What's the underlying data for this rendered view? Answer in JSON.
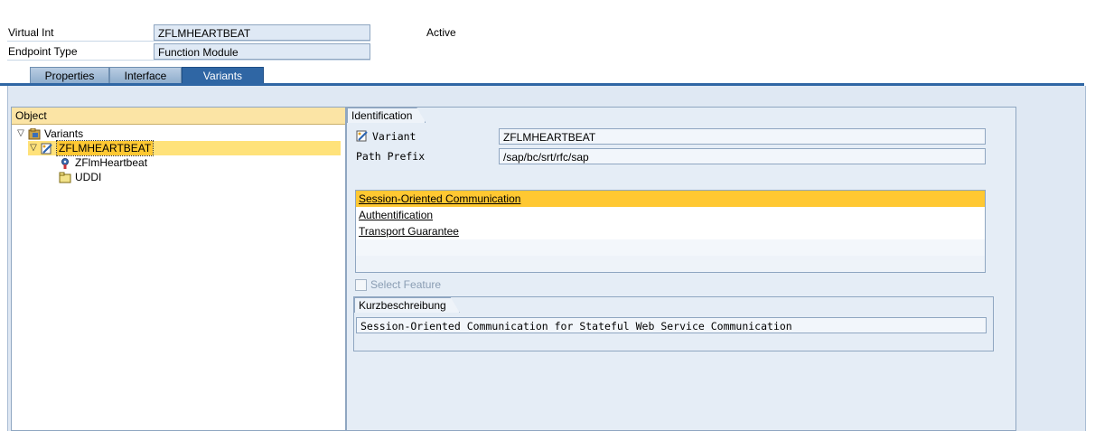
{
  "header": {
    "virtual_int_label": "Virtual Int",
    "virtual_int_value": "ZFLMHEARTBEAT",
    "status": "Active",
    "endpoint_type_label": "Endpoint Type",
    "endpoint_type_value": "Function Module"
  },
  "tabs": [
    {
      "label": "Properties"
    },
    {
      "label": "Interface"
    },
    {
      "label": "Variants"
    }
  ],
  "tree": {
    "header": "Object",
    "items": [
      {
        "label": "Variants",
        "icon": "variants-folder-icon"
      },
      {
        "label": "ZFLMHEARTBEAT",
        "icon": "variant-edit-icon"
      },
      {
        "label": "ZFlmHeartbeat",
        "icon": "service-gear-icon"
      },
      {
        "label": "UDDI",
        "icon": "folder-icon"
      }
    ]
  },
  "identification": {
    "group_label": "Identification",
    "variant_label": "Variant",
    "variant_value": "ZFLMHEARTBEAT",
    "path_prefix_label": "Path Prefix",
    "path_prefix_value": "/sap/bc/srt/rfc/sap"
  },
  "features": {
    "items": [
      {
        "label": "Session-Oriented Communication"
      },
      {
        "label": "Authentification"
      },
      {
        "label": "Transport Guarantee"
      }
    ],
    "select_feature_label": "Select Feature"
  },
  "kurzbeschreibung": {
    "group_label": "Kurzbeschreibung",
    "text": "Session-Oriented Communication for Stateful Web Service Communication"
  },
  "colors": {
    "tab_active": "#2f66a4",
    "selection": "#ffc832",
    "field_bg": "#dfe9f5",
    "tree_header": "#fbe4a5"
  }
}
